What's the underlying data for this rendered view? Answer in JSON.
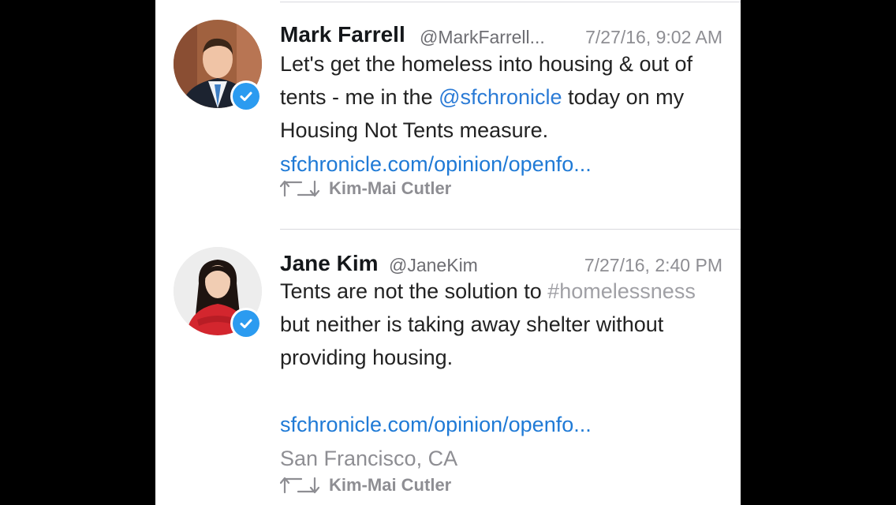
{
  "tweets": [
    {
      "name": "Mark Farrell",
      "handle": "@MarkFarrell...",
      "time": "7/27/16, 9:02 AM",
      "text_before": "Let's get the homeless into housing & out of tents - me in the ",
      "mention": "@sfchronicle",
      "text_after": " today on my Housing Not Tents measure.",
      "link": "sfchronicle.com/opinion/openfo...",
      "retweeted_by": "Kim-Mai Cutler"
    },
    {
      "name": "Jane Kim",
      "handle": "@JaneKim",
      "time": "7/27/16, 2:40 PM",
      "text_before": "Tents are not the solution to ",
      "hashtag": "#homelessness",
      "text_after": " but neither is taking away shelter without providing housing.",
      "link": "sfchronicle.com/opinion/openfo...",
      "location": "San Francisco, CA",
      "retweeted_by": "Kim-Mai Cutler"
    }
  ],
  "icons": {
    "verified": "verified-badge-icon",
    "retweet": "retweet-icon"
  },
  "colors": {
    "link": "#1f7ad6",
    "mention": "#2b7bd6",
    "hashtag": "#a0a0a5",
    "verified": "#2b9bf0",
    "muted": "#8e8e93"
  }
}
